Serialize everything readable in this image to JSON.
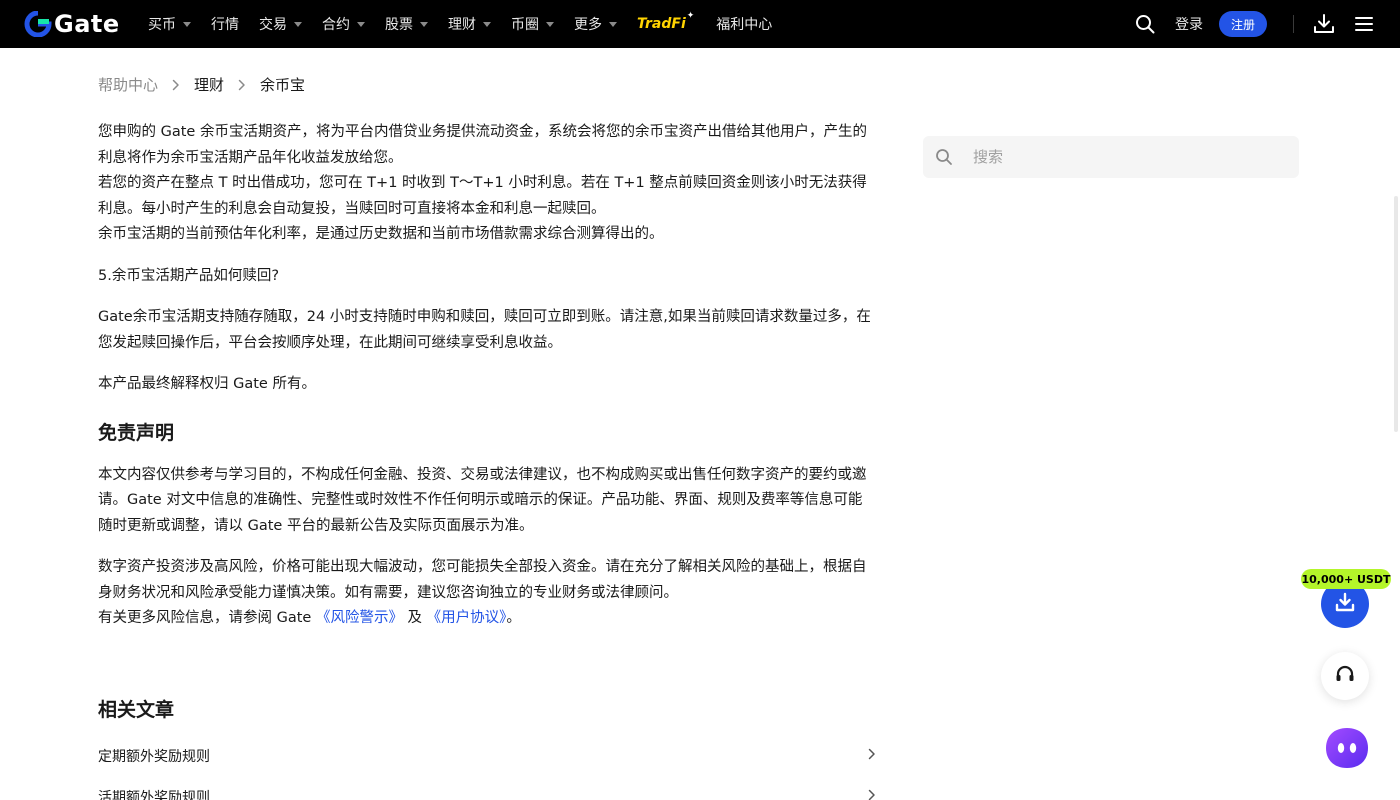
{
  "nav": {
    "logo_text": "Gate",
    "items": [
      {
        "label": "买币",
        "has_caret": true
      },
      {
        "label": "行情",
        "has_caret": false
      },
      {
        "label": "交易",
        "has_caret": true
      },
      {
        "label": "合约",
        "has_caret": true
      },
      {
        "label": "股票",
        "has_caret": true
      },
      {
        "label": "理财",
        "has_caret": true
      },
      {
        "label": "币圈",
        "has_caret": true
      },
      {
        "label": "更多",
        "has_caret": true
      }
    ],
    "tradfi_label": "TradFi",
    "welfare_label": "福利中心",
    "login_label": "登录",
    "register_label": "注册",
    "icons": [
      "search-icon",
      "download-icon",
      "menu-icon"
    ]
  },
  "breadcrumb": {
    "home": "帮助中心",
    "level1": "理财",
    "level2": "余币宝"
  },
  "article": {
    "p1": "您申购的 Gate 余币宝活期资产，将为平台内借贷业务提供流动资金，系统会将您的余币宝资产出借给其他用户，产生的利息将作为余币宝活期产品年化收益发放给您。",
    "p2": "若您的资产在整点 T 时出借成功，您可在 T+1 时收到 T～T+1 小时利息。若在 T+1 整点前赎回资金则该小时无法获得利息。每小时产生的利息会自动复投，当赎回时可直接将本金和利息一起赎回。",
    "p3": "余币宝活期的当前预估年化利率，是通过历史数据和当前市场借款需求综合测算得出的。",
    "q5": "5.余币宝活期产品如何赎回?",
    "p4": "Gate余币宝活期支持随存随取，24 小时支持随时申购和赎回，赎回可立即到账。请注意,如果当前赎回请求数量过多，在您发起赎回操作后，平台会按顺序处理，在此期间可继续享受利息收益。",
    "p5": "本产品最终解释权归 Gate 所有。",
    "disclaimer_title": "免责声明",
    "p6": "本文内容仅供参考与学习目的，不构成任何金融、投资、交易或法律建议，也不构成购买或出售任何数字资产的要约或邀请。Gate 对文中信息的准确性、完整性或时效性不作任何明示或暗示的保证。产品功能、界面、规则及费率等信息可能随时更新或调整，请以 Gate 平台的最新公告及实际页面展示为准。",
    "p7": "数字资产投资涉及高风险，价格可能出现大幅波动，您可能损失全部投入资金。请在充分了解相关风险的基础上，根据自身财务状况和风险承受能力谨慎决策。如有需要，建议您咨询独立的专业财务或法律顾问。",
    "p8_prefix": "有关更多风险信息，请参阅 Gate ",
    "p8_link1": "《风险警示》",
    "p8_mid": " 及 ",
    "p8_link2": "《用户协议》",
    "p8_suffix": "。"
  },
  "related": {
    "title": "相关文章",
    "items": [
      "定期额外奖励规则",
      "活期额外奖励规则"
    ]
  },
  "sidebar": {
    "search_placeholder": "搜索"
  },
  "floating": {
    "promo": "10,000+ USDT",
    "icons": [
      "download-icon",
      "headset-icon",
      "bot-icon"
    ]
  },
  "colors": {
    "nav_bg": "#000000",
    "brand_blue": "#2354e6",
    "tradfi_yellow": "#ffd400",
    "promo_green": "#b4f52a",
    "bot_purple": "#7b3ff2"
  }
}
